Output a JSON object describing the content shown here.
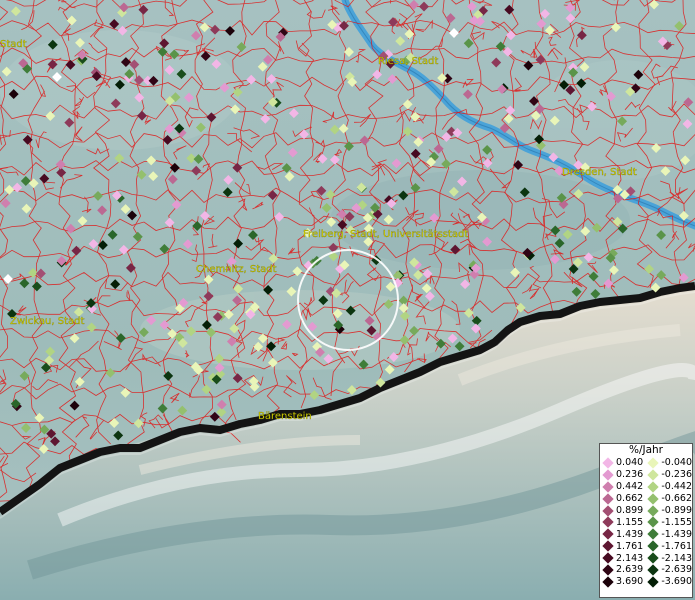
{
  "map": {
    "cities": [
      {
        "name": "Stadt"
      },
      {
        "name": "Riesa, Stadt"
      },
      {
        "name": "Dresden, Stadt"
      },
      {
        "name": "Freiberg, Stadt, Universitätsstadt"
      },
      {
        "name": "Chemnitz, Stadt"
      },
      {
        "name": "Zwickau, Stadt"
      },
      {
        "name": "Bärenstein"
      }
    ],
    "colors": {
      "river": "#4aa3d8",
      "border": "#1a1a1a",
      "municipal_lines": "#e01818",
      "highlight_circle": "#ffffff"
    }
  },
  "legend": {
    "title": "%/Jahr",
    "positive": [
      {
        "value": "0.040",
        "color": "#f2b6e6"
      },
      {
        "value": "0.236",
        "color": "#e39ad1"
      },
      {
        "value": "0.442",
        "color": "#cf7fae"
      },
      {
        "value": "0.662",
        "color": "#bb6892"
      },
      {
        "value": "0.899",
        "color": "#a34f73"
      },
      {
        "value": "1.155",
        "color": "#8e3a5a"
      },
      {
        "value": "1.439",
        "color": "#772645"
      },
      {
        "value": "1.761",
        "color": "#5e1631"
      },
      {
        "value": "2.143",
        "color": "#470a21"
      },
      {
        "value": "2.639",
        "color": "#300515"
      },
      {
        "value": "3.690",
        "color": "#1c020a"
      }
    ],
    "negative": [
      {
        "value": "-0.040",
        "color": "#e9f5b8"
      },
      {
        "value": "-0.236",
        "color": "#cfe69d"
      },
      {
        "value": "-0.442",
        "color": "#b1d483"
      },
      {
        "value": "-0.662",
        "color": "#94c06e"
      },
      {
        "value": "-0.899",
        "color": "#77aa5c"
      },
      {
        "value": "-1.155",
        "color": "#5a9449"
      },
      {
        "value": "-1.439",
        "color": "#3f7d39"
      },
      {
        "value": "-1.761",
        "color": "#2a662a"
      },
      {
        "value": "-2.143",
        "color": "#194d1b"
      },
      {
        "value": "-2.639",
        "color": "#0c3510"
      },
      {
        "value": "-3.690",
        "color": "#041e06"
      }
    ]
  }
}
